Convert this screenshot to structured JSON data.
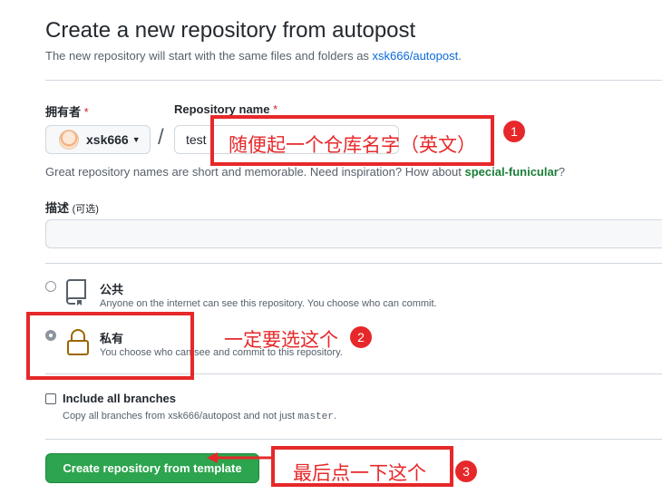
{
  "header": {
    "title": "Create a new repository from autopost",
    "subtitle_prefix": "The new repository will start with the same files and folders as ",
    "template_link": "xsk666/autopost",
    "subtitle_suffix": "."
  },
  "owner": {
    "label": "拥有者",
    "required_mark": "*",
    "value": "xsk666"
  },
  "repo_name": {
    "label": "Repository name",
    "required_mark": "*",
    "value": "test"
  },
  "separator": "/",
  "hint": {
    "text": "Great repository names are short and memorable. Need inspiration? How about ",
    "suggestion": "special-funicular",
    "suffix": "?"
  },
  "description": {
    "label": "描述",
    "optional": "(可选)",
    "value": ""
  },
  "visibility": {
    "public": {
      "title": "公共",
      "desc": "Anyone on the internet can see this repository. You choose who can commit."
    },
    "private": {
      "title": "私有",
      "desc": "You choose who can see and commit to this repository."
    },
    "selected": "private"
  },
  "branches": {
    "label": "Include all branches",
    "desc_prefix": "Copy all branches from xsk666/autopost and not just ",
    "desc_code": "master",
    "desc_suffix": ".",
    "checked": false
  },
  "create_button": "Create repository from template",
  "annotations": {
    "a1": "随便起一个仓库名字（英文）",
    "a2": "一定要选这个",
    "a3": "最后点一下这个",
    "b1": "1",
    "b2": "2",
    "b3": "3",
    "color": "#e6282a"
  }
}
